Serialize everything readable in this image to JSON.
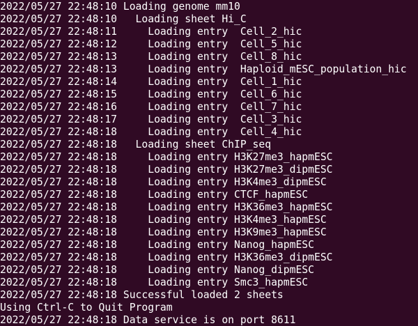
{
  "terminal": {
    "lines": [
      "2022/05/27 22:48:10 Loading genome mm10",
      "2022/05/27 22:48:10   Loading sheet Hi_C",
      "2022/05/27 22:48:11     Loading entry  Cell_2_hic",
      "2022/05/27 22:48:12     Loading entry  Cell_5_hic",
      "2022/05/27 22:48:13     Loading entry  Cell_8_hic",
      "2022/05/27 22:48:13     Loading entry  Haploid_mESC_population_hic",
      "2022/05/27 22:48:14     Loading entry  Cell_1_hic",
      "2022/05/27 22:48:15     Loading entry  Cell_6_hic",
      "2022/05/27 22:48:16     Loading entry  Cell_7_hic",
      "2022/05/27 22:48:17     Loading entry  Cell_3_hic",
      "2022/05/27 22:48:18     Loading entry  Cell_4_hic",
      "2022/05/27 22:48:18   Loading sheet ChIP_seq",
      "2022/05/27 22:48:18     Loading entry H3K27me3_hapmESC",
      "2022/05/27 22:48:18     Loading entry H3K27me3_dipmESC",
      "2022/05/27 22:48:18     Loading entry H3K4me3_dipmESC",
      "2022/05/27 22:48:18     Loading entry CTCF_hapmESC",
      "2022/05/27 22:48:18     Loading entry H3K36me3_hapmESC",
      "2022/05/27 22:48:18     Loading entry H3K4me3_hapmESC",
      "2022/05/27 22:48:18     Loading entry H3K9me3_hapmESC",
      "2022/05/27 22:48:18     Loading entry Nanog_hapmESC",
      "2022/05/27 22:48:18     Loading entry H3K36me3_dipmESC",
      "2022/05/27 22:48:18     Loading entry Nanog_dipmESC",
      "2022/05/27 22:48:18     Loading entry Smc3_hapmESC",
      "2022/05/27 22:48:18 Successful loaded 2 sheets",
      "Using Ctrl-C to Quit Program",
      "2022/05/27 22:48:18 Data service is on port 8611"
    ],
    "colors": {
      "background": "#300a24",
      "text": "#ffffff"
    }
  }
}
